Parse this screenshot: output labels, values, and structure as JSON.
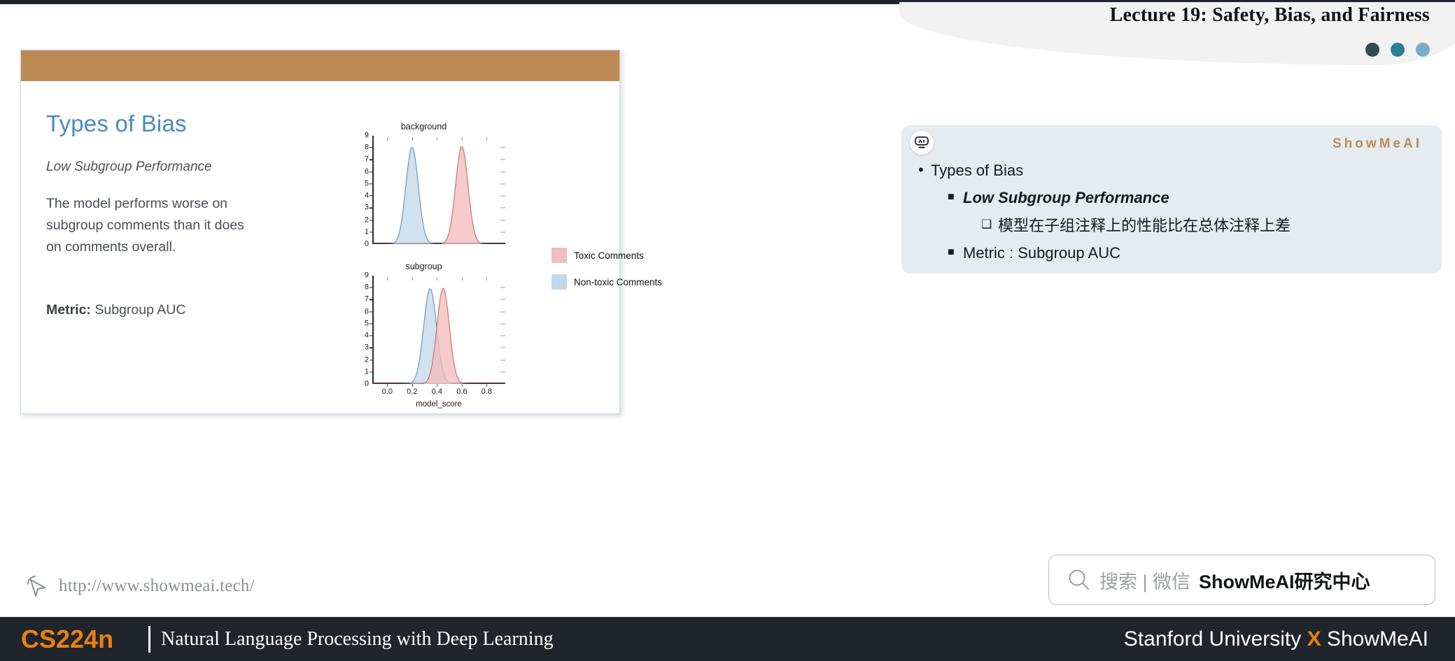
{
  "header": {
    "title": "Lecture 19: Safety, Bias, and Fairness",
    "dots": [
      {
        "name": "dot-dark",
        "color": "#2f4a52"
      },
      {
        "name": "dot-teal",
        "color": "#2b7e96"
      },
      {
        "name": "dot-light",
        "color": "#7aadc4"
      }
    ]
  },
  "slide": {
    "bar_color": "#bd8a56",
    "title": "Types of Bias",
    "subtitle": "Low Subgroup Performance",
    "paragraph": "The model performs worse on subgroup comments than it does on comments overall.",
    "metric_label": "Metric:",
    "metric_value": "Subgroup AUC"
  },
  "chart_data": {
    "type": "area",
    "title": "",
    "xlabel": "model_score",
    "ylabel": "",
    "xlim": [
      -0.12,
      0.95
    ],
    "xticks": [
      "0.0",
      "0.2",
      "0.4",
      "0.6",
      "0.8"
    ],
    "xtick_values": [
      0.0,
      0.2,
      0.4,
      0.6,
      0.8
    ],
    "ylim": [
      0,
      9
    ],
    "yticks": [
      "0",
      "1",
      "2",
      "3",
      "4",
      "5",
      "6",
      "7",
      "8",
      "9"
    ],
    "ytick_values": [
      0,
      1,
      2,
      3,
      4,
      5,
      6,
      7,
      8,
      9
    ],
    "grid": false,
    "legend_position": "right",
    "legend": [
      {
        "label": "Toxic Comments",
        "color": "#f2bdbd"
      },
      {
        "label": "Non-toxic Comments",
        "color": "#c3d8ea"
      }
    ],
    "panels": [
      {
        "title": "background",
        "series": [
          {
            "name": "Non-toxic Comments",
            "color": "#c3d8ea",
            "line": "#4d7fa5",
            "kind": "kde",
            "mean": 0.2,
            "sigma": 0.05,
            "peak": 8.05
          },
          {
            "name": "Toxic Comments",
            "color": "#f2bdbd",
            "line": "#c0564f",
            "kind": "kde",
            "mean": 0.6,
            "sigma": 0.05,
            "peak": 8.1
          }
        ]
      },
      {
        "title": "subgroup",
        "series": [
          {
            "name": "Non-toxic Comments",
            "color": "#c3d8ea",
            "line": "#4d7fa5",
            "kind": "kde",
            "mean": 0.345,
            "sigma": 0.052,
            "peak": 7.9
          },
          {
            "name": "Toxic Comments",
            "color": "#f2bdbd",
            "line": "#c0564f",
            "kind": "kde",
            "mean": 0.45,
            "sigma": 0.05,
            "peak": 7.95
          }
        ]
      }
    ]
  },
  "footer_link": {
    "icon": "cursor-click-icon",
    "url": "http://www.showmeai.tech/"
  },
  "panel": {
    "badge_icon": "showmeai-robot-icon",
    "logo": "ShowMeAI",
    "items": [
      {
        "level": 1,
        "bullet": "•",
        "text": "Types of Bias",
        "italic": false
      },
      {
        "level": 2,
        "bullet": "■",
        "text": "Low Subgroup Performance",
        "italic": true
      },
      {
        "level": 3,
        "bullet": "❑",
        "text": "模型在子组注释上的性能比在总体注释上差",
        "italic": false
      },
      {
        "level": 2,
        "bullet": "■",
        "text": "Metric : Subgroup AUC",
        "italic": false
      }
    ]
  },
  "search": {
    "icon": "search-icon",
    "placeholder": "搜索 | 微信",
    "brand": "ShowMeAI研究中心"
  },
  "bottom_bar": {
    "course_code": "CS224n",
    "course_name": "Natural Language Processing with Deep Learning",
    "right_prefix": "Stanford University ",
    "right_x": "X",
    "right_suffix": " ShowMeAI",
    "accent_color": "#e8820c"
  }
}
